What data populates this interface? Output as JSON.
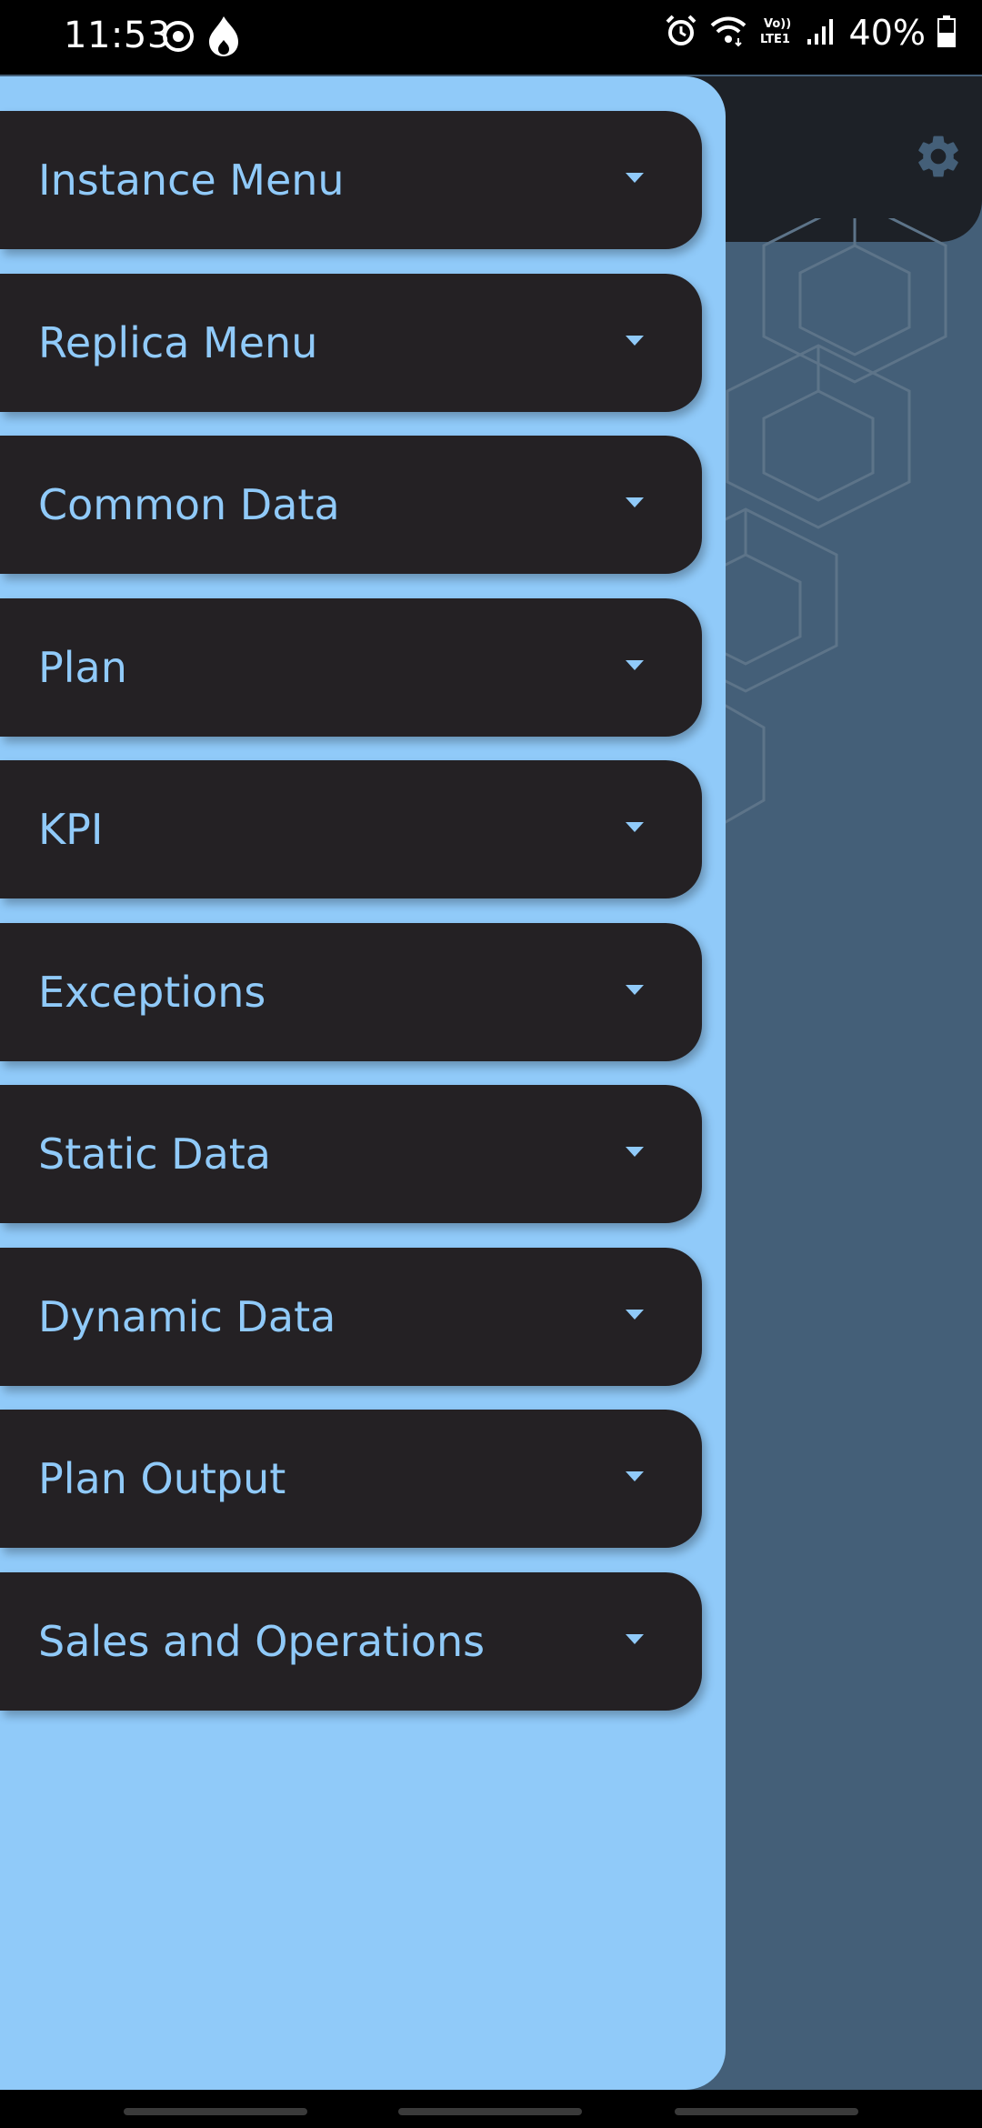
{
  "status_bar": {
    "time": "11:53",
    "battery": "40%",
    "icons": [
      "target-icon",
      "flame-icon",
      "alarm-icon",
      "wifi-icon",
      "volte-icon",
      "signal-icon",
      "battery-icon"
    ]
  },
  "drawer": {
    "items": [
      {
        "label": "Instance Menu"
      },
      {
        "label": "Replica Menu"
      },
      {
        "label": "Common Data"
      },
      {
        "label": "Plan"
      },
      {
        "label": "KPI"
      },
      {
        "label": "Exceptions"
      },
      {
        "label": "Static Data"
      },
      {
        "label": "Dynamic Data"
      },
      {
        "label": "Plan Output"
      },
      {
        "label": "Sales and Operations"
      }
    ]
  },
  "colors": {
    "drawer_bg": "#90caf9",
    "item_bg": "#242124",
    "item_text": "#90caf9",
    "app_bg": "#445f78",
    "header_bg": "#1d2127"
  }
}
